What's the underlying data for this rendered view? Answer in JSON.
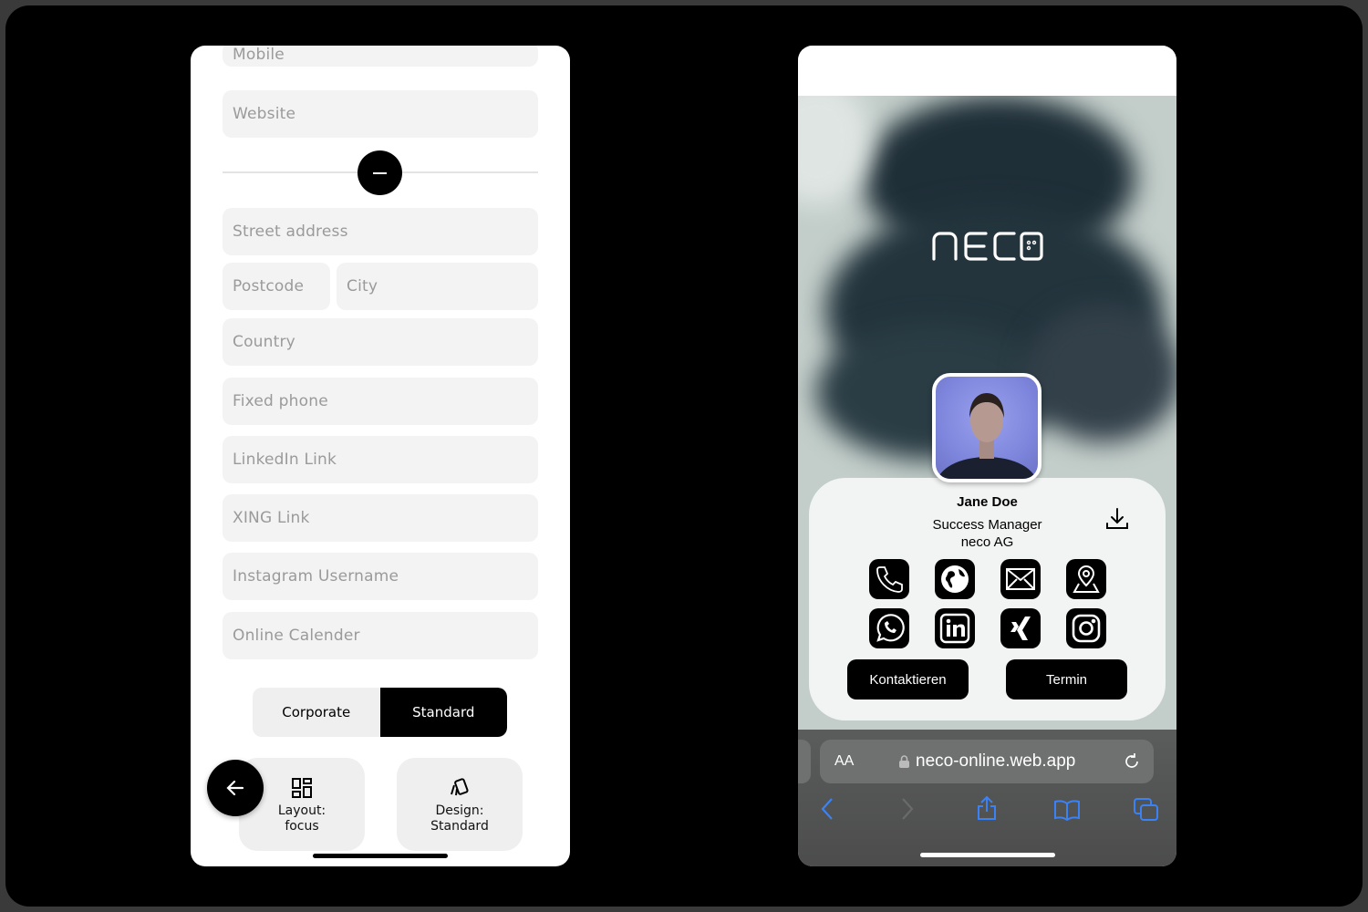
{
  "editor": {
    "fields": {
      "mobile": "Mobile",
      "website": "Website",
      "street": "Street address",
      "postcode": "Postcode",
      "city": "City",
      "country": "Country",
      "fixed_phone": "Fixed phone",
      "linkedin": "LinkedIn Link",
      "xing": "XING Link",
      "instagram": "Instagram Username",
      "calendar": "Online Calender"
    },
    "segment": {
      "options": [
        "Corporate",
        "Standard"
      ],
      "selected": "Standard"
    },
    "layout_card": {
      "label": "Layout:",
      "value": "focus"
    },
    "design_card": {
      "label": "Design:",
      "value": "Standard"
    }
  },
  "preview": {
    "logo": "neco",
    "name": "Jane Doe",
    "role": "Success Manager",
    "company": "neco AG",
    "icons": [
      "phone-icon",
      "globe-icon",
      "mail-icon",
      "map-pin-icon",
      "whatsapp-icon",
      "linkedin-icon",
      "xing-icon",
      "instagram-icon"
    ],
    "buttons": {
      "contact": "Kontaktieren",
      "appointment": "Termin"
    },
    "browser": {
      "text_size": "AA",
      "url": "neco-online.web.app",
      "accent": "#3b82f6"
    }
  }
}
